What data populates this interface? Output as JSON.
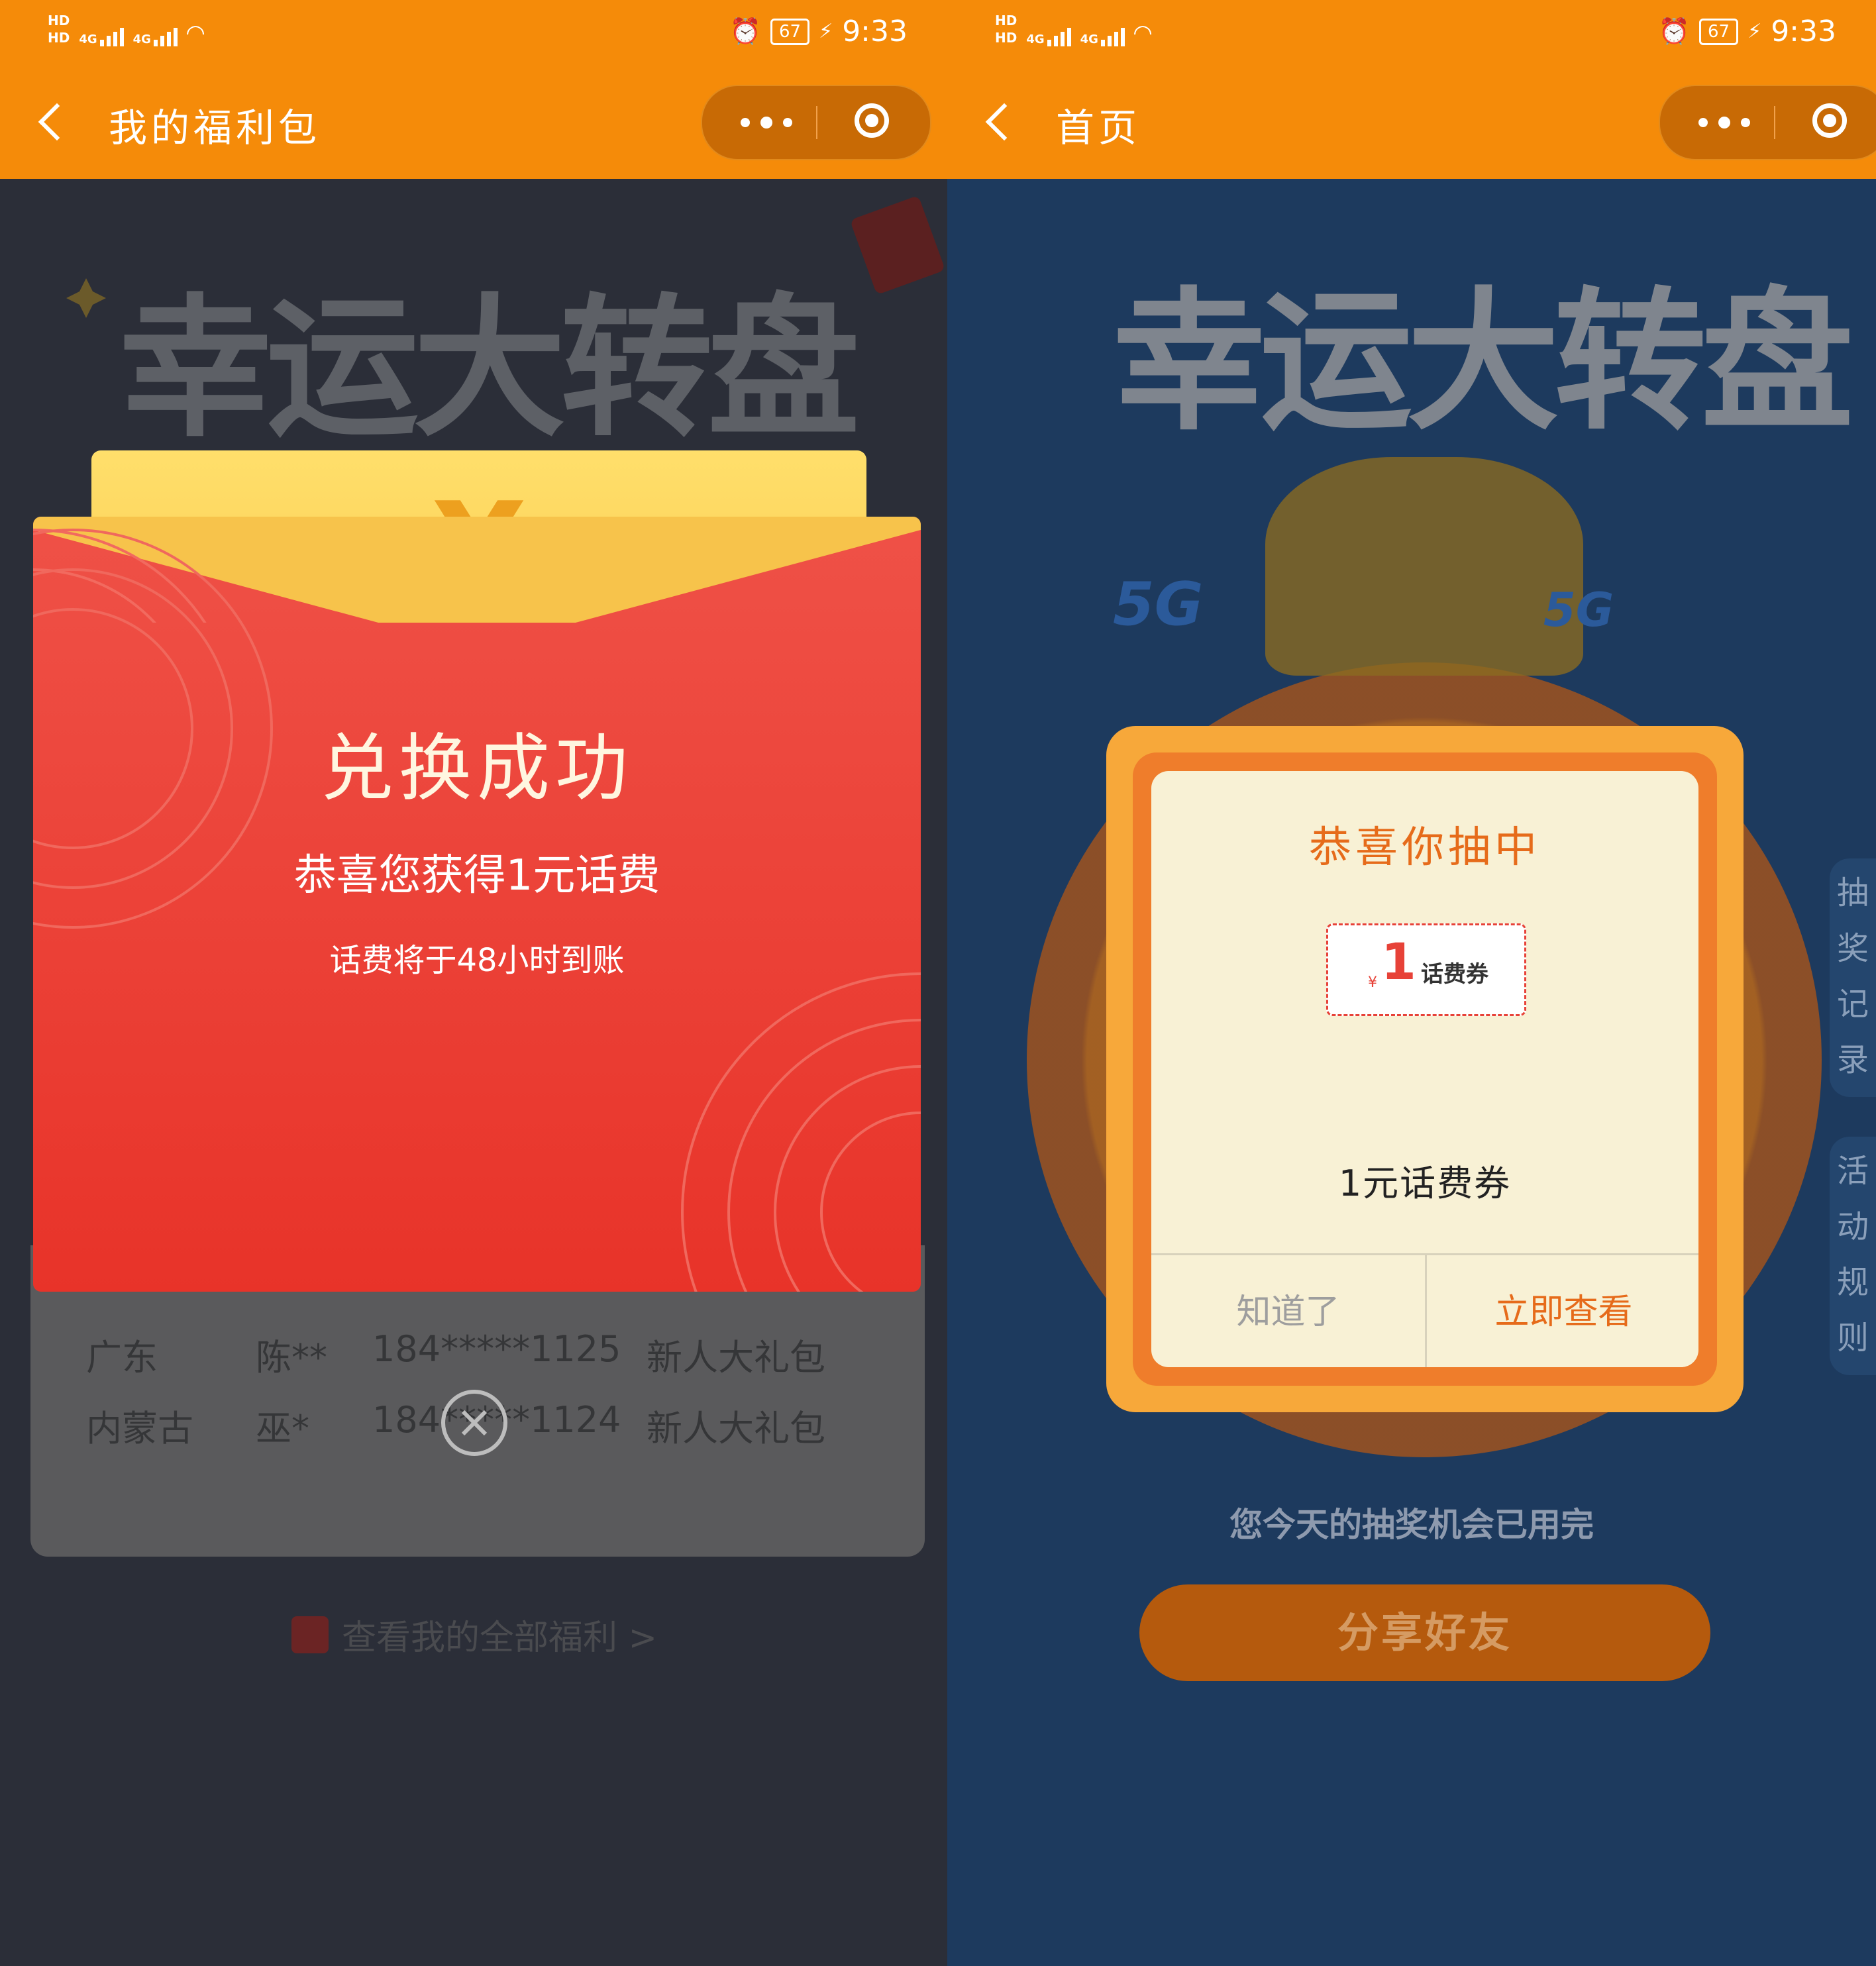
{
  "status": {
    "hd1": "HD",
    "hd2": "HD",
    "net1": "4G",
    "net2": "4G",
    "battery": "67",
    "time": "9:33"
  },
  "left": {
    "header_title": "我的福利包",
    "big_title": "幸运大转盘",
    "envelope": {
      "currency": "¥",
      "title": "兑换成功",
      "subtitle": "恭喜您获得1元话费",
      "note": "话费将于48小时到账"
    },
    "ticker_rows": [
      {
        "region": "广东",
        "name": "陈**",
        "phone": "184*****1125",
        "prize": "新人大礼包"
      },
      {
        "region": "内蒙古",
        "name": "巫*",
        "phone": "184*****1124",
        "prize": "新人大礼包"
      }
    ],
    "all_link": "查看我的全部福利 >"
  },
  "right": {
    "header_title": "首页",
    "big_title": "幸运大转盘",
    "logo": "5G",
    "side_tabs": [
      "抽奖记录",
      "活动规则"
    ],
    "modal": {
      "title": "恭喜你抽中",
      "ticket_currency": "¥",
      "ticket_amount": "1",
      "ticket_label": "话费券",
      "prize_name": "1元话费券",
      "btn_know": "知道了",
      "btn_view": "立即查看"
    },
    "chances_text": "您今天的抽奖机会已用完",
    "share_button": "分享好友"
  },
  "colors": {
    "brand_orange": "#f58b09",
    "envelope_red": "#e83329",
    "accent_text": "#e66b1a"
  }
}
